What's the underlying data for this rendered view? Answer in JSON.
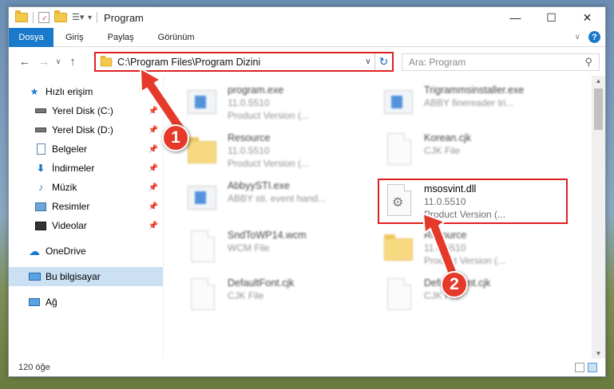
{
  "window": {
    "title": "Program"
  },
  "ribbon": {
    "tabs": [
      "Dosya",
      "Giriş",
      "Paylaş",
      "Görünüm"
    ]
  },
  "address": {
    "path": "C:\\Program Files\\Program Dizini",
    "search_placeholder": "Ara: Program"
  },
  "sidebar": {
    "items": [
      {
        "label": "Hızlı erişim",
        "icon": "star-icon"
      },
      {
        "label": "Yerel Disk (C:)",
        "icon": "drive-icon"
      },
      {
        "label": "Yerel Disk (D:)",
        "icon": "drive-icon"
      },
      {
        "label": "Belgeler",
        "icon": "documents-icon"
      },
      {
        "label": "İndirmeler",
        "icon": "download-icon"
      },
      {
        "label": "Müzik",
        "icon": "music-icon"
      },
      {
        "label": "Resimler",
        "icon": "pictures-icon"
      },
      {
        "label": "Videolar",
        "icon": "videos-icon"
      },
      {
        "label": "OneDrive",
        "icon": "cloud-icon"
      },
      {
        "label": "Bu bilgisayar",
        "icon": "computer-icon"
      },
      {
        "label": "Ağ",
        "icon": "network-icon"
      }
    ]
  },
  "files": [
    {
      "name": "program.exe",
      "line2": "11.0.5510",
      "line3": "Product Version (...",
      "icon": "exe-icon"
    },
    {
      "name": "Trigrammsinstaller.exe",
      "line2": "ABBY finereader tri...",
      "line3": "",
      "icon": "exe-icon"
    },
    {
      "name": "Resource",
      "line2": "11.0.5510",
      "line3": "Product Version (...",
      "icon": "folder-icon"
    },
    {
      "name": "Korean.cjk",
      "line2": "CJK File",
      "line3": "",
      "icon": "file-icon"
    },
    {
      "name": "AbbyySTI.exe",
      "line2": "ABBY sti. event hand...",
      "line3": "",
      "icon": "exe-icon"
    },
    {
      "name": "msosvint.dll",
      "line2": "11.0.5510",
      "line3": "Product Version (...",
      "icon": "dll-icon"
    },
    {
      "name": "SndToWP14.wcm",
      "line2": "WCM File",
      "line3": "",
      "icon": "file-icon"
    },
    {
      "name": "Resource",
      "line2": "11.0.5510",
      "line3": "Product Version (...",
      "icon": "folder-icon"
    },
    {
      "name": "DefaultFont.cjk",
      "line2": "CJK File",
      "line3": "",
      "icon": "file-icon"
    },
    {
      "name": "DefaultFont.cjk",
      "line2": "CJK File",
      "line3": "",
      "icon": "file-icon"
    }
  ],
  "status": {
    "count": "120 öğe"
  },
  "callouts": [
    "1",
    "2"
  ],
  "colors": {
    "accent": "#1979ca",
    "highlight": "#e02020",
    "badge": "#e53a2a"
  }
}
